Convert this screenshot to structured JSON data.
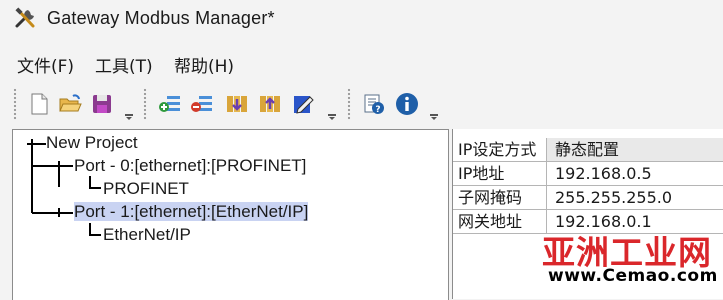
{
  "window": {
    "title": "Gateway Modbus Manager*",
    "icon": "tools-icon"
  },
  "menu": [
    {
      "label": "文件(F)"
    },
    {
      "label": "工具(T)"
    },
    {
      "label": "帮助(H)"
    }
  ],
  "toolbar": {
    "groups": [
      [
        "new-file-icon",
        "open-folder-icon",
        "save-icon"
      ],
      [
        "add-item-icon",
        "remove-item-icon",
        "import-icon",
        "export-icon",
        "edit-icon"
      ],
      [
        "help-icon",
        "info-icon"
      ]
    ]
  },
  "tree": {
    "root": "New Project",
    "ports": [
      {
        "label": "Port - 0:[ethernet]:[PROFINET]",
        "child": "PROFINET",
        "selected": false
      },
      {
        "label": "Port - 1:[ethernet]:[EtherNet/IP]",
        "child": "EtherNet/IP",
        "selected": true
      }
    ]
  },
  "properties": [
    {
      "key": "IP设定方式",
      "value": "静态配置"
    },
    {
      "key": "IP地址",
      "value": "192.168.0.5"
    },
    {
      "key": "子网掩码",
      "value": "255.255.255.0"
    },
    {
      "key": "网关地址",
      "value": "192.168.0.1"
    }
  ],
  "watermark": {
    "main": "亚洲工业网",
    "url": "www.Cemao.com"
  },
  "colors": {
    "selection": "#c9d3f2",
    "accent_blue": "#1f5fa8",
    "watermark_red": "#d7151a"
  }
}
